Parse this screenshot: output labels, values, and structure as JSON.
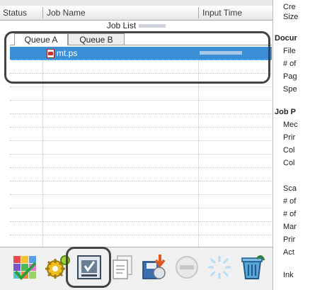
{
  "header": {
    "status_label": "Status",
    "job_name_label": "Job Name",
    "input_time_label": "Input Time"
  },
  "job_list": {
    "title": "Job List"
  },
  "tabs": [
    {
      "label": "Queue A",
      "active": true
    },
    {
      "label": "Queue B",
      "active": false
    }
  ],
  "jobs": [
    {
      "name": "mt.ps",
      "file_icon": "pdf-file-icon",
      "selected": true
    }
  ],
  "toolbar": {
    "buttons": [
      {
        "name": "color-palette-button",
        "icon": "palette-check-icon"
      },
      {
        "name": "settings-button",
        "icon": "gear-icon"
      },
      {
        "name": "device-button",
        "icon": "device-check-icon",
        "highlighted": true
      },
      {
        "name": "documents-button",
        "icon": "document-stack-icon"
      },
      {
        "name": "save-to-disk-button",
        "icon": "disk-arrow-icon"
      },
      {
        "name": "cancel-button",
        "icon": "minus-circle-icon"
      },
      {
        "name": "processing-button",
        "icon": "spinner-icon"
      },
      {
        "name": "delete-button",
        "icon": "trash-icon"
      }
    ]
  },
  "properties": {
    "items": [
      {
        "text": "Cre",
        "kind": "item"
      },
      {
        "text": "Size",
        "kind": "item"
      },
      {
        "text": "Docur",
        "kind": "head"
      },
      {
        "text": "File",
        "kind": "item"
      },
      {
        "text": "# of",
        "kind": "item"
      },
      {
        "text": "Pag",
        "kind": "item"
      },
      {
        "text": "Spe",
        "kind": "item"
      },
      {
        "text": "Job P",
        "kind": "head"
      },
      {
        "text": "Mec",
        "kind": "item"
      },
      {
        "text": "Prir",
        "kind": "item"
      },
      {
        "text": "Col",
        "kind": "item"
      },
      {
        "text": "Col",
        "kind": "item"
      },
      {
        "text": "Sca",
        "kind": "item"
      },
      {
        "text": "# of",
        "kind": "item"
      },
      {
        "text": "# of",
        "kind": "item"
      },
      {
        "text": "Mar",
        "kind": "item"
      },
      {
        "text": "Prir",
        "kind": "item"
      },
      {
        "text": "Act",
        "kind": "item"
      },
      {
        "text": "Ink",
        "kind": "item"
      }
    ]
  },
  "colors": {
    "selection": "#3c8fd5",
    "callout_border": "#444444"
  }
}
